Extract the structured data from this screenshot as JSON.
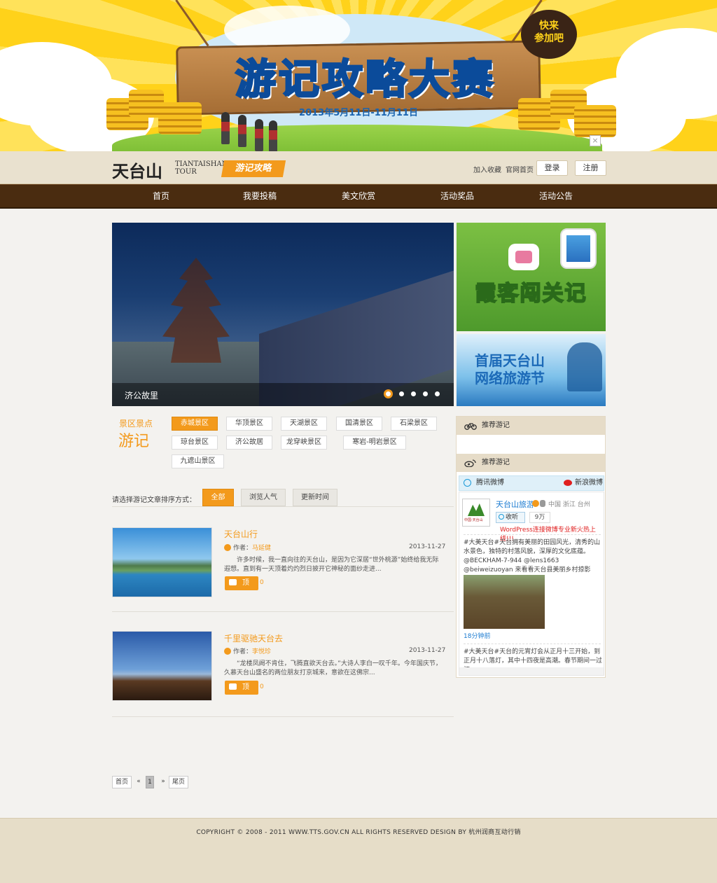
{
  "banner": {
    "title": "游记攻略大赛",
    "date_range": "2013年5月11日-11月11日",
    "bubble_line1": "快来",
    "bubble_line2": "参加吧",
    "close_label": "×"
  },
  "header": {
    "logo_cn": "天台山",
    "logo_en_line1": "TIANTAISHAN",
    "logo_en_line2": "TOUR",
    "logo_tag": "游记攻略",
    "add_favorite": "加入收藏",
    "official_home": "官网首页",
    "login": "登录",
    "register": "注册"
  },
  "nav": [
    "首页",
    "我要投稿",
    "美文欣赏",
    "活动奖品",
    "活动公告"
  ],
  "slider": {
    "caption": "济公故里",
    "active_index": 0,
    "dot_count": 5
  },
  "promos": {
    "promo1_title": "霞客闯关记",
    "promo2_line1": "首届天台山",
    "promo2_line2": "网络旅游节"
  },
  "scenic": {
    "label_small": "景区景点",
    "label_big": "游记",
    "tags": [
      "赤城景区",
      "华顶景区",
      "天湖景区",
      "国清景区",
      "石梁景区",
      "琼台景区",
      "济公故居",
      "龙穿峡景区",
      "寒岩-明岩景区",
      "九遮山景区"
    ],
    "active": "赤城景区"
  },
  "sort": {
    "label": "请选择游记文章排序方式：",
    "options": [
      "全部",
      "浏览人气",
      "更新时间"
    ],
    "active": "全部"
  },
  "articles": [
    {
      "title": "天台山行",
      "author_label": "作者：",
      "author": "马延健",
      "date": "2013-11-27",
      "excerpt": "许多时候，我一直向往的天台山，是因为它深居“世外桃源”始终给我无际遐想。直到有一天顶着灼灼烈日披开它神秘的面纱走进...",
      "like_label": "顶",
      "likes": "0"
    },
    {
      "title": "千里驱驰天台去",
      "author_label": "作者：",
      "author": "李悦珍",
      "date": "2013-11-27",
      "excerpt": "“龙楼凤阙不肯住，飞腾直欲天台去。”大诗人李白一叹千年。今年国庆节，久慕天台山盛名的两位朋友打京城来，意欲在这佛宗...",
      "like_label": "顶",
      "likes": "0"
    }
  ],
  "pagination": {
    "first": "首页",
    "prev": "«",
    "current": "1",
    "next": "»",
    "last": "尾页"
  },
  "sidebar": {
    "head1": "推荐游记",
    "head2": "推荐游记",
    "tencent": "腾讯微博",
    "sina": "新浪微博",
    "account_name": "天台山旅游",
    "location": "中国 浙江 台州",
    "follow": "收听",
    "follower_count": "9万",
    "logo_text": "中国·天台山",
    "promo_link": "WordPress连接微博专业新火热上线!!!",
    "post1": "#大美天台#天台拥有美丽的田园风光，清秀的山水景色，独特的村落风貌，深厚的文化底蕴。@BECKHAM-7-944 @lens1663 @beiweizuoyan 来看看天台县美丽乡村掠影",
    "time1": "18分钟前",
    "post2": "#大美天台#天台的元宵灯会从正月十三开始，到正月十八落灯，其中十四夜是高潮。春节期间一过初"
  },
  "footer": {
    "text": "COPYRIGHT © 2008 - 2011  WWW.TTS.GOV.CN  ALL RIGHTS RESERVED DESIGN BY  杭州润商互动行销"
  },
  "colors": {
    "accent": "#f39a1c",
    "nav_bg": "#4a2c10",
    "header_bg": "#e9e1cf",
    "weibo_blue": "#1a7ad0"
  }
}
